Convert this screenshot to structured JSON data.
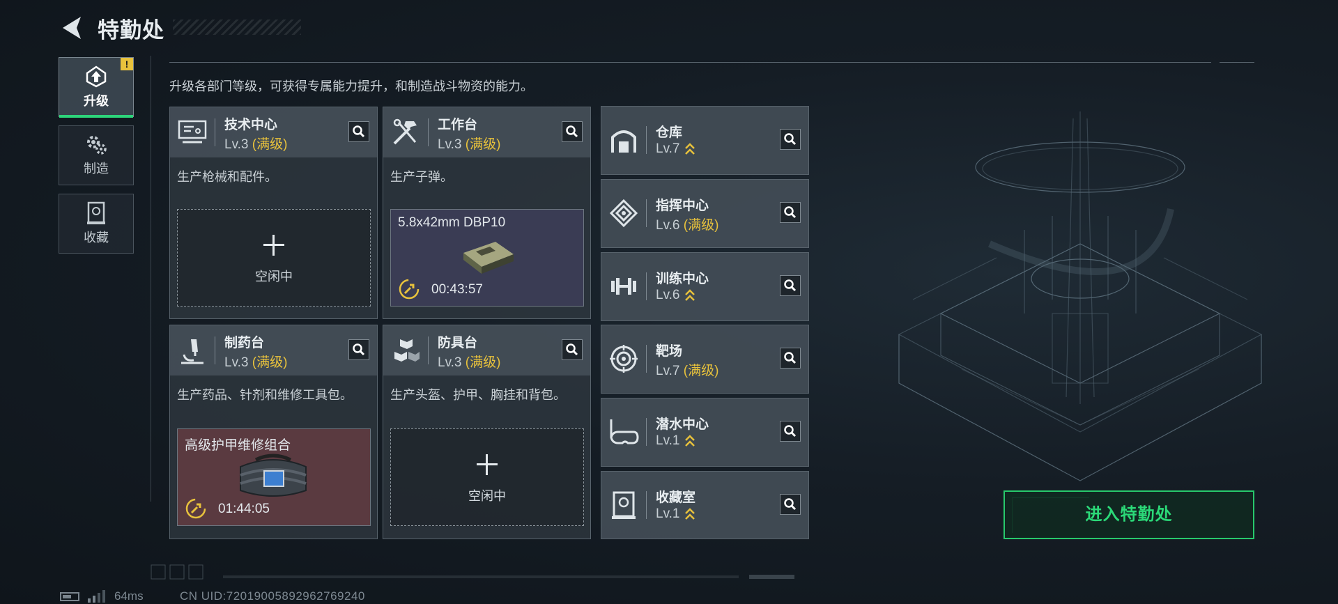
{
  "header": {
    "title": "特勤处"
  },
  "description": "升级各部门等级，可获得专属能力提升，和制造战斗物资的能力。",
  "nav": [
    {
      "label": "升级",
      "icon": "upgrade-icon",
      "active": true,
      "badge": "!"
    },
    {
      "label": "制造",
      "icon": "gears-icon",
      "active": false
    },
    {
      "label": "收藏",
      "icon": "collection-icon",
      "active": false
    }
  ],
  "cards": {
    "tech": {
      "name": "技术中心",
      "level": "Lv.3",
      "max": "(满级)",
      "desc": "生产枪械和配件。",
      "idle": "空闲中"
    },
    "workbench": {
      "name": "工作台",
      "level": "Lv.3",
      "max": "(满级)",
      "desc": "生产子弹。",
      "item": "5.8x42mm DBP10",
      "timer": "00:43:57"
    },
    "pharmacy": {
      "name": "制药台",
      "level": "Lv.3",
      "max": "(满级)",
      "desc": "生产药品、针剂和维修工具包。",
      "item": "高级护甲维修组合",
      "timer": "01:44:05"
    },
    "armor": {
      "name": "防具台",
      "level": "Lv.3",
      "max": "(满级)",
      "desc": "生产头盔、护甲、胸挂和背包。",
      "idle": "空闲中"
    }
  },
  "departments": [
    {
      "name": "仓库",
      "level": "Lv.7",
      "max": "",
      "upgradable": true,
      "icon": "warehouse-icon"
    },
    {
      "name": "指挥中心",
      "level": "Lv.6",
      "max": "(满级)",
      "upgradable": false,
      "icon": "command-icon"
    },
    {
      "name": "训练中心",
      "level": "Lv.6",
      "max": "",
      "upgradable": true,
      "icon": "dumbbell-icon"
    },
    {
      "name": "靶场",
      "level": "Lv.7",
      "max": "(满级)",
      "upgradable": false,
      "icon": "target-icon"
    },
    {
      "name": "潜水中心",
      "level": "Lv.1",
      "max": "",
      "upgradable": true,
      "icon": "diving-mask-icon"
    },
    {
      "name": "收藏室",
      "level": "Lv.1",
      "max": "",
      "upgradable": true,
      "icon": "collection-room-icon"
    }
  ],
  "enter_button": "进入特勤处",
  "status": {
    "ping": "64ms",
    "uid": "CN UID:72019005892962769240"
  },
  "colors": {
    "accent_green": "#2bd978",
    "max_level_yellow": "#e8c23c",
    "pharmacy_bg": "#5a3a40",
    "workbench_bg": "#3a3c54"
  }
}
